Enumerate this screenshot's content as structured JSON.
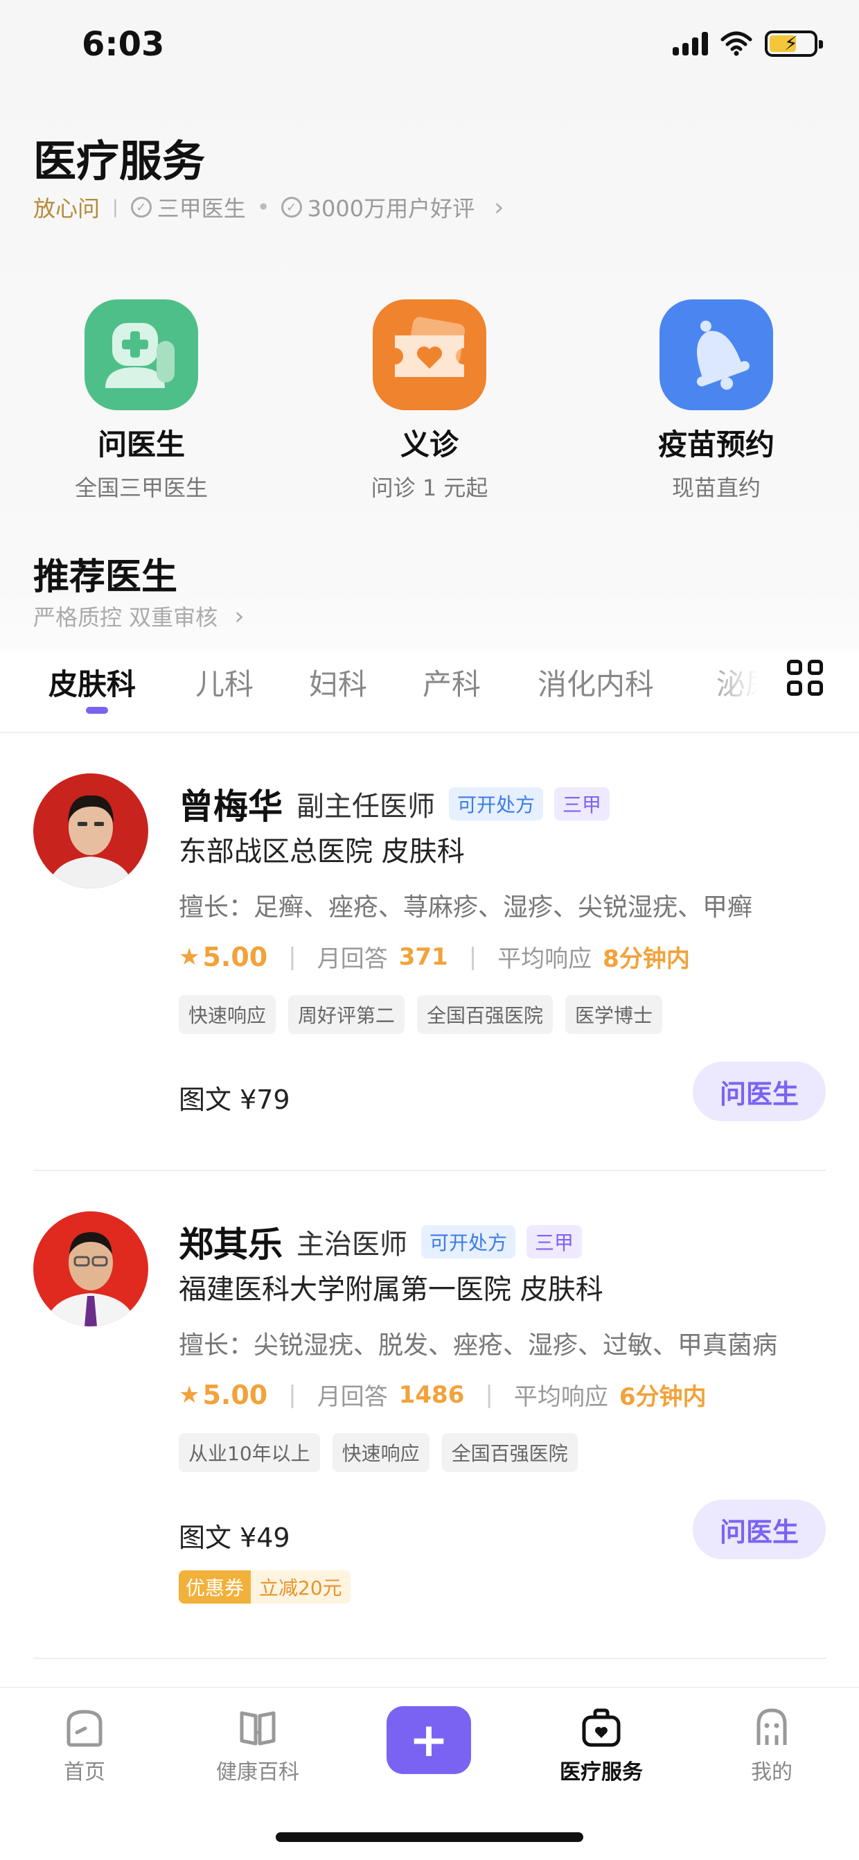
{
  "status_bar": {
    "time": "6:03"
  },
  "header": {
    "title": "医疗服务",
    "brand": "放心问",
    "badge_1": "三甲医生",
    "badge_2": "3000万用户好评"
  },
  "services": [
    {
      "name": "问医生",
      "desc": "全国三甲医生",
      "color": "#4fbf8a"
    },
    {
      "name": "义诊",
      "desc": "问诊 1 元起",
      "color": "#f0832d"
    },
    {
      "name": "疫苗预约",
      "desc": "现苗直约",
      "color": "#4b86f0"
    }
  ],
  "recommend": {
    "title": "推荐医生",
    "subtitle": "严格质控 双重审核"
  },
  "tabs": [
    "皮肤科",
    "儿科",
    "妇科",
    "产科",
    "消化内科",
    "泌尿"
  ],
  "active_tab": "皮肤科",
  "doctors": [
    {
      "name": "曾梅华",
      "title": "副主任医师",
      "badge_rx": "可开处方",
      "badge_grade": "三甲",
      "hospital": "东部战区总医院  皮肤科",
      "skill": "擅长：足癣、痤疮、荨麻疹、湿疹、尖锐湿疣、甲癣",
      "rating": "5.00",
      "monthly_label": "月回答",
      "monthly_value": "371",
      "response_label": "平均响应",
      "response_value": "8分钟内",
      "tags": [
        "快速响应",
        "周好评第二",
        "全国百强医院",
        "医学博士"
      ],
      "price": "图文 ¥79",
      "ask_label": "问医生"
    },
    {
      "name": "郑其乐",
      "title": "主治医师",
      "badge_rx": "可开处方",
      "badge_grade": "三甲",
      "hospital": "福建医科大学附属第一医院  皮肤科",
      "skill": "擅长：尖锐湿疣、脱发、痤疮、湿疹、过敏、甲真菌病",
      "rating": "5.00",
      "monthly_label": "月回答",
      "monthly_value": "1486",
      "response_label": "平均响应",
      "response_value": "6分钟内",
      "tags": [
        "从业10年以上",
        "快速响应",
        "全国百强医院"
      ],
      "price": "图文 ¥49",
      "ask_label": "问医生",
      "coupon_label": "优惠券",
      "coupon_text": "立减20元"
    }
  ],
  "bottom_nav": [
    {
      "label": "首页",
      "icon": "home-icon"
    },
    {
      "label": "健康百科",
      "icon": "book-icon"
    },
    {
      "label": "+",
      "icon": "plus-icon"
    },
    {
      "label": "医疗服务",
      "icon": "medical-bag-icon"
    },
    {
      "label": "我的",
      "icon": "profile-icon"
    }
  ],
  "colors": {
    "accent": "#7a63f2",
    "orange": "#f2a23a",
    "brand_gold": "#b58a3a"
  }
}
